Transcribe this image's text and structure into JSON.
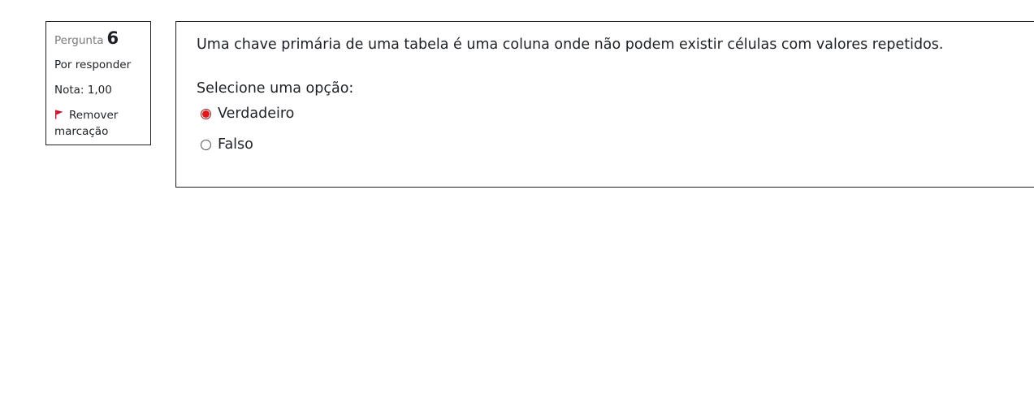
{
  "question_info": {
    "label": "Pergunta",
    "number": "6",
    "state": "Por responder",
    "grade": "Nota: 1,00",
    "flag_text": "Remover marcação",
    "flag_color": "#c8102e"
  },
  "question": {
    "text": "Uma chave primária de uma tabela é uma coluna onde não podem existir células com valores repetidos.",
    "prompt": "Selecione uma opção:",
    "options": [
      {
        "label": "Verdadeiro",
        "selected": true
      },
      {
        "label": "Falso",
        "selected": false
      }
    ],
    "selected_color": "#e0161b"
  }
}
